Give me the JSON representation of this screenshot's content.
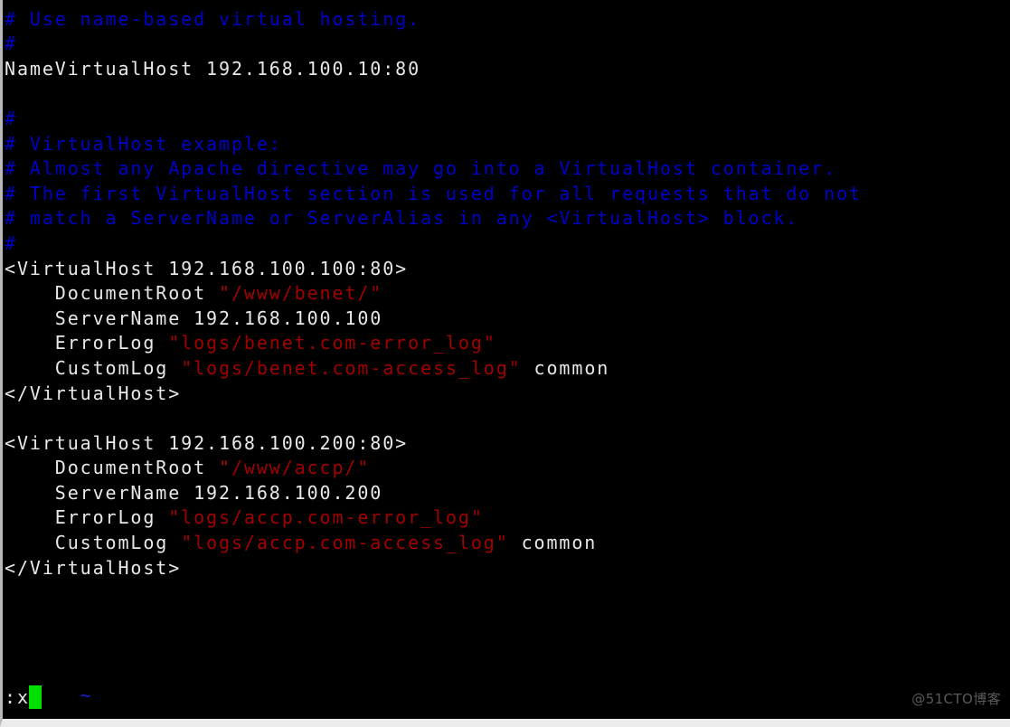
{
  "window": {
    "app": "vim",
    "background_color": "#000000",
    "frame_color": "#ececec"
  },
  "colors": {
    "comment": "#0000c8",
    "string": "#a00000",
    "normal_text": "#e8e8e8",
    "tilde": "#1a1ad6",
    "cursor": "#00e000",
    "watermark": "#5a5a5a"
  },
  "editor": {
    "lines": [
      {
        "id": "l01",
        "segments": [
          {
            "class": "cmt",
            "text": "#"
          }
        ]
      },
      {
        "id": "l02",
        "segments": [
          {
            "class": "cmt",
            "text": "# Use name-based virtual hosting."
          }
        ]
      },
      {
        "id": "l03",
        "segments": [
          {
            "class": "cmt",
            "text": "#"
          }
        ]
      },
      {
        "id": "l04",
        "segments": [
          {
            "class": "txt",
            "text": "NameVirtualHost 192.168.100.10:80"
          }
        ]
      },
      {
        "id": "l05",
        "segments": [
          {
            "class": "txt",
            "text": ""
          }
        ]
      },
      {
        "id": "l06",
        "segments": [
          {
            "class": "cmt",
            "text": "#"
          }
        ]
      },
      {
        "id": "l07",
        "segments": [
          {
            "class": "cmt",
            "text": "# VirtualHost example:"
          }
        ]
      },
      {
        "id": "l08",
        "segments": [
          {
            "class": "cmt",
            "text": "# Almost any Apache directive may go into a VirtualHost container."
          }
        ]
      },
      {
        "id": "l09",
        "segments": [
          {
            "class": "cmt",
            "text": "# The first VirtualHost section is used for all requests that do not"
          }
        ]
      },
      {
        "id": "l10",
        "segments": [
          {
            "class": "cmt",
            "text": "# match a ServerName or ServerAlias in any <VirtualHost> block."
          }
        ]
      },
      {
        "id": "l11",
        "segments": [
          {
            "class": "cmt",
            "text": "#"
          }
        ]
      },
      {
        "id": "l12",
        "segments": [
          {
            "class": "txt",
            "text": "<VirtualHost 192.168.100.100:80>"
          }
        ]
      },
      {
        "id": "l13",
        "segments": [
          {
            "class": "txt",
            "text": "    DocumentRoot "
          },
          {
            "class": "str",
            "text": "\"/www/benet/\""
          }
        ]
      },
      {
        "id": "l14",
        "segments": [
          {
            "class": "txt",
            "text": "    ServerName 192.168.100.100"
          }
        ]
      },
      {
        "id": "l15",
        "segments": [
          {
            "class": "txt",
            "text": "    ErrorLog "
          },
          {
            "class": "str",
            "text": "\"logs/benet.com-error_log\""
          }
        ]
      },
      {
        "id": "l16",
        "segments": [
          {
            "class": "txt",
            "text": "    CustomLog "
          },
          {
            "class": "str",
            "text": "\"logs/benet.com-access_log\""
          },
          {
            "class": "txt",
            "text": " common"
          }
        ]
      },
      {
        "id": "l17",
        "segments": [
          {
            "class": "txt",
            "text": "</VirtualHost>"
          }
        ]
      },
      {
        "id": "l18",
        "segments": [
          {
            "class": "txt",
            "text": ""
          }
        ]
      },
      {
        "id": "l19",
        "segments": [
          {
            "class": "txt",
            "text": "<VirtualHost 192.168.100.200:80>"
          }
        ]
      },
      {
        "id": "l20",
        "segments": [
          {
            "class": "txt",
            "text": "    DocumentRoot "
          },
          {
            "class": "str",
            "text": "\"/www/accp/\""
          }
        ]
      },
      {
        "id": "l21",
        "segments": [
          {
            "class": "txt",
            "text": "    ServerName 192.168.100.200"
          }
        ]
      },
      {
        "id": "l22",
        "segments": [
          {
            "class": "txt",
            "text": "    ErrorLog "
          },
          {
            "class": "str",
            "text": "\"logs/accp.com-error_log\""
          }
        ]
      },
      {
        "id": "l23",
        "segments": [
          {
            "class": "txt",
            "text": "    CustomLog "
          },
          {
            "class": "str",
            "text": "\"logs/accp.com-access_log\""
          },
          {
            "class": "txt",
            "text": " common"
          }
        ]
      },
      {
        "id": "l24",
        "segments": [
          {
            "class": "txt",
            "text": "</VirtualHost>"
          }
        ]
      },
      {
        "id": "l25",
        "segments": [
          {
            "class": "txt",
            "text": ""
          }
        ]
      },
      {
        "id": "l26",
        "segments": [
          {
            "class": "txt",
            "text": ""
          }
        ]
      }
    ]
  },
  "empty_line_marker": "~",
  "command_line": {
    "text": ":x",
    "cursor_visible": true
  },
  "watermark": {
    "text": "@51CTO博客"
  }
}
